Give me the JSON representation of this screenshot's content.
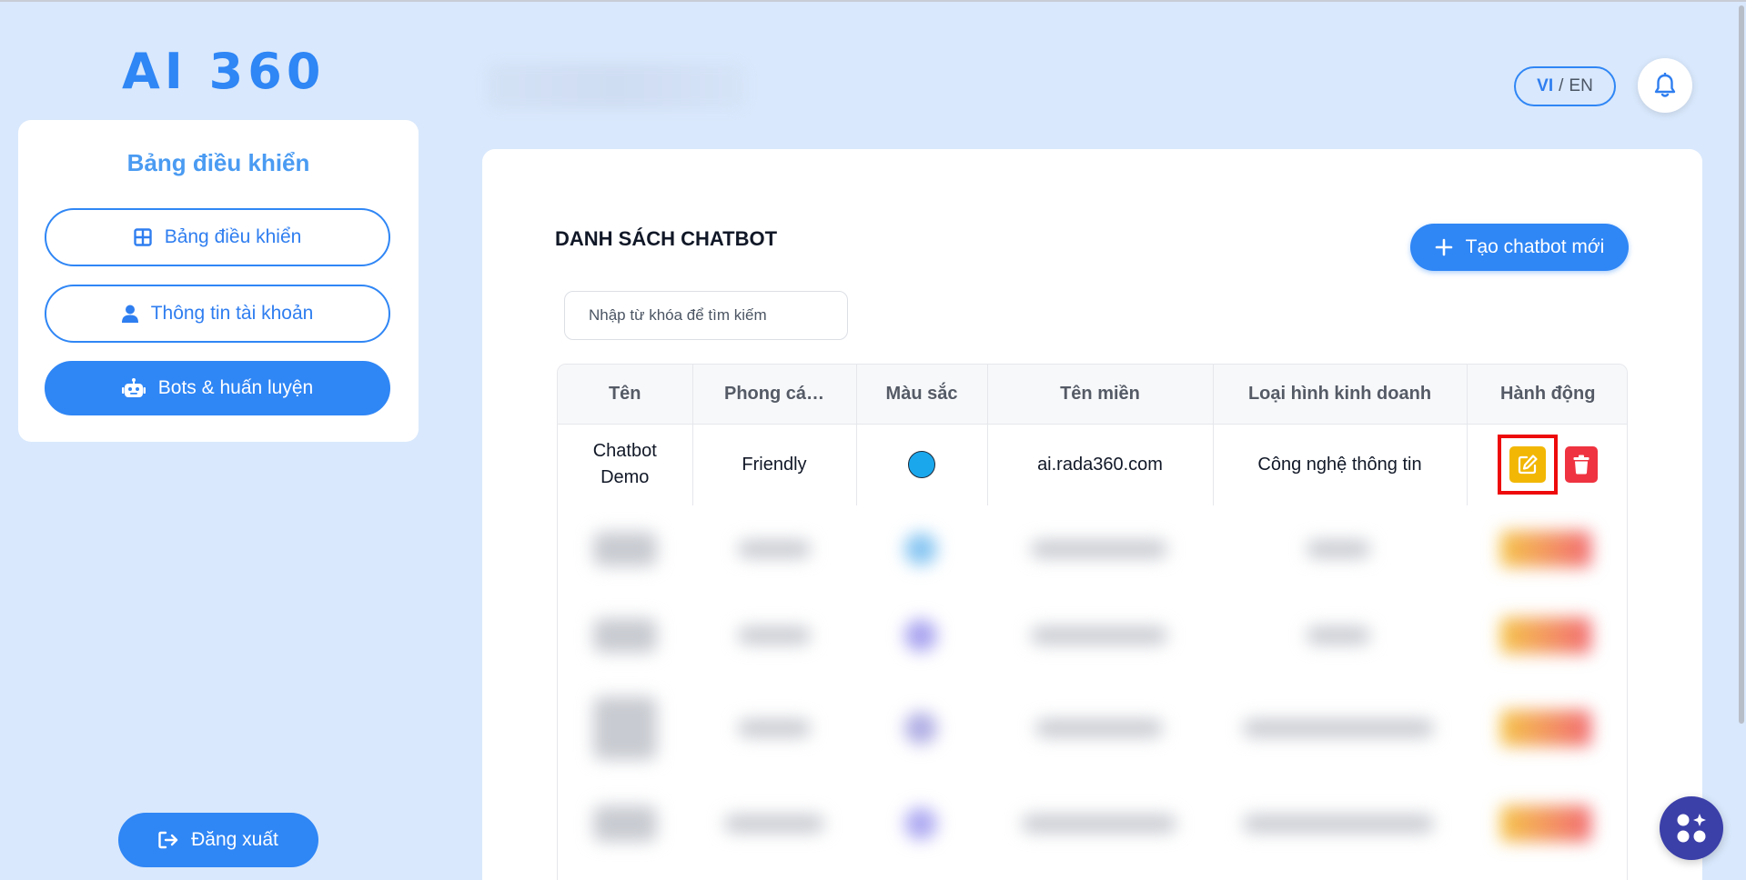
{
  "app": {
    "logo_text": "AI 360"
  },
  "sidebar": {
    "title": "Bảng điều khiển",
    "items": [
      {
        "label": "Bảng điều khiển",
        "icon": "dashboard-grid-icon",
        "active": false
      },
      {
        "label": "Thông tin tài khoản",
        "icon": "user-icon",
        "active": false
      },
      {
        "label": "Bots & huấn luyện",
        "icon": "robot-icon",
        "active": true
      }
    ],
    "logout_label": "Đăng xuất"
  },
  "header": {
    "lang_vi": "VI",
    "lang_sep": "/",
    "lang_en": "EN",
    "bell_icon": "bell-icon"
  },
  "main": {
    "title": "DANH SÁCH CHATBOT",
    "create_button_label": "Tạo chatbot mới",
    "search_placeholder": "Nhập từ khóa để tìm kiếm",
    "table": {
      "columns": [
        "Tên",
        "Phong cá…",
        "Màu sắc",
        "Tên miền",
        "Loại hình kinh doanh",
        "Hành động"
      ],
      "rows": [
        {
          "name": "Chatbot Demo",
          "style": "Friendly",
          "color": "#1aa7ec",
          "domain": "ai.rada360.com",
          "business_type": "Công nghệ thông tin"
        }
      ]
    }
  },
  "colors": {
    "primary": "#2f86f5",
    "background": "#d9e8fc",
    "edit": "#f2b705",
    "delete": "#ef3340",
    "highlight": "#ee0a0a"
  }
}
